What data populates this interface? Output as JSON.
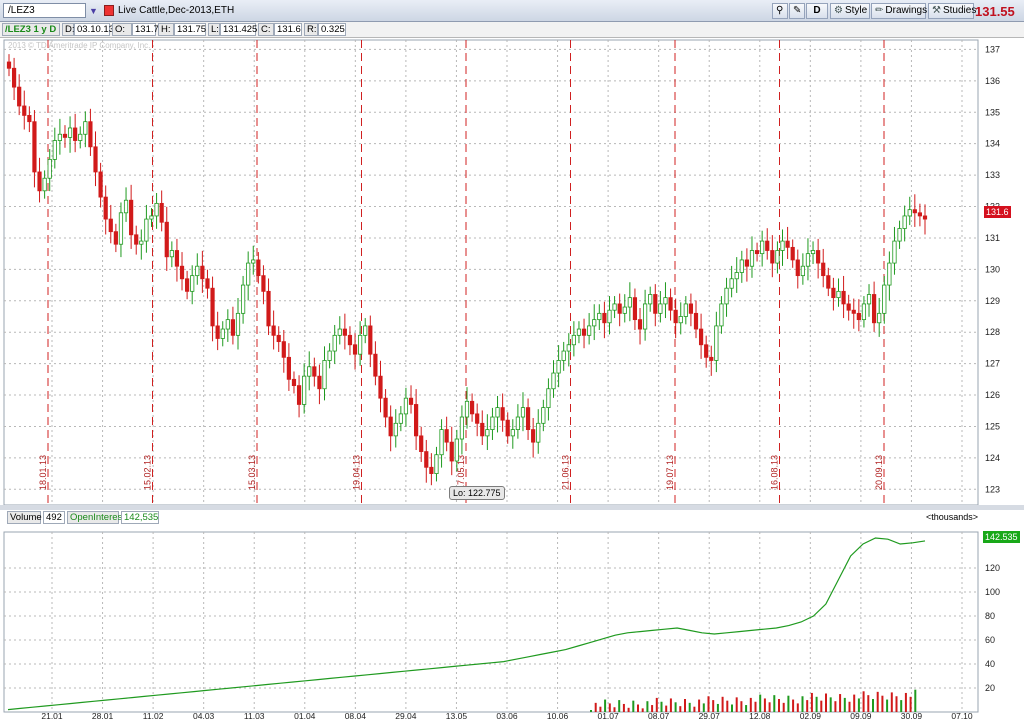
{
  "toolbar": {
    "symbol": "/LEZ3",
    "description": "Live Cattle,Dec-2013,ETH",
    "period_button": "D",
    "style_label": "Style",
    "drawings_label": "Drawings",
    "studies_label": "Studies",
    "last_price": "131.55"
  },
  "info": {
    "title": "/LEZ3 1 y D",
    "date_label": "D:",
    "date": "03.10.13",
    "open_label": "O:",
    "open": "131.7",
    "high_label": "H:",
    "high": "131.75",
    "low_label": "L:",
    "low": "131.425",
    "close_label": "C:",
    "close": "131.6",
    "range_label": "R:",
    "range": "0.325",
    "watermark": "2013 © TD Ameritrade IP Company, Inc."
  },
  "lower": {
    "volume_label": "Volume",
    "volume": "492",
    "oi_label": "OpenInterest",
    "oi": "142,535",
    "units": "<thousands>",
    "oi_badge": "142.535"
  },
  "chart_data": [
    {
      "type": "candlestick",
      "title": "",
      "ylim": [
        122.5,
        137.3
      ],
      "y_ticks": [
        123,
        124,
        125,
        126,
        127,
        128,
        129,
        130,
        131,
        132,
        133,
        134,
        135,
        136,
        137
      ],
      "x_ticks": [
        "21.01",
        "28.01",
        "11.02",
        "04.03",
        "11.03",
        "01.04",
        "08.04",
        "29.04",
        "13.05",
        "03.06",
        "10.06",
        "01.07",
        "08.07",
        "29.07",
        "12.08",
        "02.09",
        "09.09",
        "30.09",
        "07.10"
      ],
      "month_markers": [
        "18.01.13",
        "15.02.13",
        "15.03.13",
        "19.04.13",
        "17.05.13",
        "21.06.13",
        "19.07.13",
        "16.08.13",
        "20.09.13"
      ],
      "low_annotation": "Lo: 122.775",
      "last_badge": "131.6",
      "closes": [
        136.4,
        135.8,
        135.2,
        134.9,
        134.7,
        133.1,
        132.5,
        132.9,
        133.5,
        134.1,
        134.3,
        134.2,
        134.5,
        134.1,
        134.3,
        134.7,
        133.9,
        133.1,
        132.3,
        131.6,
        131.2,
        130.8,
        131.8,
        132.2,
        131.1,
        130.8,
        130.9,
        131.6,
        131.7,
        132.1,
        131.5,
        130.4,
        130.6,
        130.1,
        129.7,
        129.3,
        129.8,
        130.1,
        129.7,
        129.4,
        128.2,
        127.8,
        128.1,
        128.4,
        127.9,
        128.6,
        129.5,
        130.2,
        130.3,
        129.8,
        129.3,
        128.2,
        127.9,
        127.7,
        127.2,
        126.5,
        126.3,
        125.7,
        126.6,
        126.9,
        126.6,
        126.2,
        127.1,
        127.4,
        127.9,
        128.1,
        127.9,
        127.6,
        127.3,
        127.9,
        128.2,
        127.3,
        126.6,
        125.9,
        125.3,
        124.7,
        125.1,
        125.4,
        125.9,
        125.7,
        124.7,
        124.2,
        123.7,
        123.5,
        124.1,
        124.9,
        124.5,
        123.9,
        124.6,
        125.3,
        125.8,
        125.4,
        125.1,
        124.7,
        124.9,
        125.3,
        125.6,
        125.2,
        124.7,
        124.9,
        125.3,
        125.6,
        124.9,
        124.5,
        125.1,
        125.6,
        126.2,
        126.7,
        127.1,
        127.4,
        127.6,
        127.9,
        128.1,
        127.9,
        128.2,
        128.4,
        128.6,
        128.3,
        128.7,
        128.9,
        128.6,
        128.8,
        129.1,
        128.4,
        128.1,
        128.9,
        129.2,
        128.6,
        128.9,
        129.1,
        128.7,
        128.3,
        128.5,
        128.9,
        128.6,
        128.1,
        127.6,
        127.2,
        127.1,
        128.2,
        128.9,
        129.4,
        129.7,
        129.9,
        130.3,
        130.1,
        130.6,
        130.5,
        130.9,
        130.6,
        130.2,
        130.6,
        130.9,
        130.7,
        130.3,
        129.8,
        130.1,
        130.5,
        130.6,
        130.2,
        129.8,
        129.4,
        129.1,
        129.3,
        128.9,
        128.7,
        128.6,
        128.4,
        128.9,
        129.2,
        128.3,
        128.6,
        129.5,
        130.2,
        130.9,
        131.3,
        131.7,
        131.9,
        131.8,
        131.7,
        131.6
      ]
    },
    {
      "type": "area",
      "title": "",
      "series": [
        {
          "name": "OpenInterest",
          "values": [
            2,
            3,
            4,
            5,
            6,
            7,
            8,
            9,
            10,
            11,
            12,
            13,
            14,
            15,
            16,
            17,
            18,
            19,
            20,
            21,
            22,
            23,
            24,
            25,
            26,
            27,
            28,
            29,
            30,
            31,
            32,
            33,
            34,
            35,
            36,
            37,
            38,
            39,
            40,
            41,
            42,
            44,
            46,
            48,
            50,
            52,
            55,
            58,
            61,
            64,
            66,
            67,
            68,
            69,
            70,
            68,
            66,
            65,
            66,
            67,
            68,
            69,
            70,
            72,
            75,
            80,
            90,
            110,
            130,
            140,
            145,
            144,
            140,
            141,
            142.535
          ]
        }
      ],
      "ylim": [
        0,
        150
      ],
      "y_ticks": [
        20,
        40,
        60,
        80,
        100,
        120
      ]
    }
  ]
}
